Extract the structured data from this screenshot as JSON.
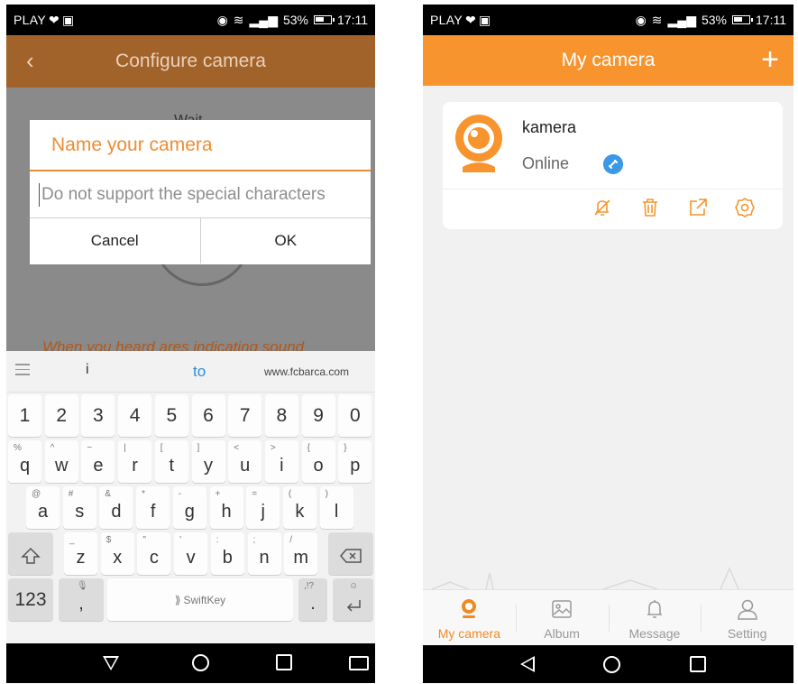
{
  "left": {
    "status": {
      "carrier": "PLAY",
      "battery": "53%",
      "time": "17:11"
    },
    "appbar": {
      "title": "Configure camera"
    },
    "background": {
      "wait_text": "Wait",
      "hint_text": "When you heard ares indicating sound"
    },
    "dialog": {
      "title": "Name your camera",
      "placeholder": "Do not support the special characters",
      "cancel": "Cancel",
      "ok": "OK"
    },
    "keyboard": {
      "suggestions": [
        "i",
        "to",
        "www.fcbarca.com"
      ],
      "numbers": [
        "1",
        "2",
        "3",
        "4",
        "5",
        "6",
        "7",
        "8",
        "9",
        "0"
      ],
      "row1": [
        "q",
        "w",
        "e",
        "r",
        "t",
        "y",
        "u",
        "i",
        "o",
        "p"
      ],
      "row1_sub": [
        "%",
        "^",
        "~",
        "|",
        "[",
        "]",
        "<",
        ">",
        "{",
        "}"
      ],
      "row2": [
        "a",
        "s",
        "d",
        "f",
        "g",
        "h",
        "j",
        "k",
        "l"
      ],
      "row2_sub": [
        "@",
        "#",
        "&",
        "*",
        "-",
        "+",
        "=",
        "(",
        ")"
      ],
      "row3": [
        "z",
        "x",
        "c",
        "v",
        "b",
        "n",
        "m"
      ],
      "row3_sub": [
        "_",
        "$",
        "\"",
        "'",
        ":",
        ";",
        "/"
      ],
      "numkey": "123",
      "comma": ",",
      "period": ".",
      "space_label": "SwiftKey",
      "punct_sub": ",!?"
    }
  },
  "right": {
    "status": {
      "carrier": "PLAY",
      "battery": "53%",
      "time": "17:11"
    },
    "appbar": {
      "title": "My camera"
    },
    "camera": {
      "name": "kamera",
      "status": "Online"
    },
    "tabs": [
      "My camera",
      "Album",
      "Message",
      "Setting"
    ],
    "colors": {
      "accent": "#f7942d",
      "link": "#3c99e8"
    }
  }
}
